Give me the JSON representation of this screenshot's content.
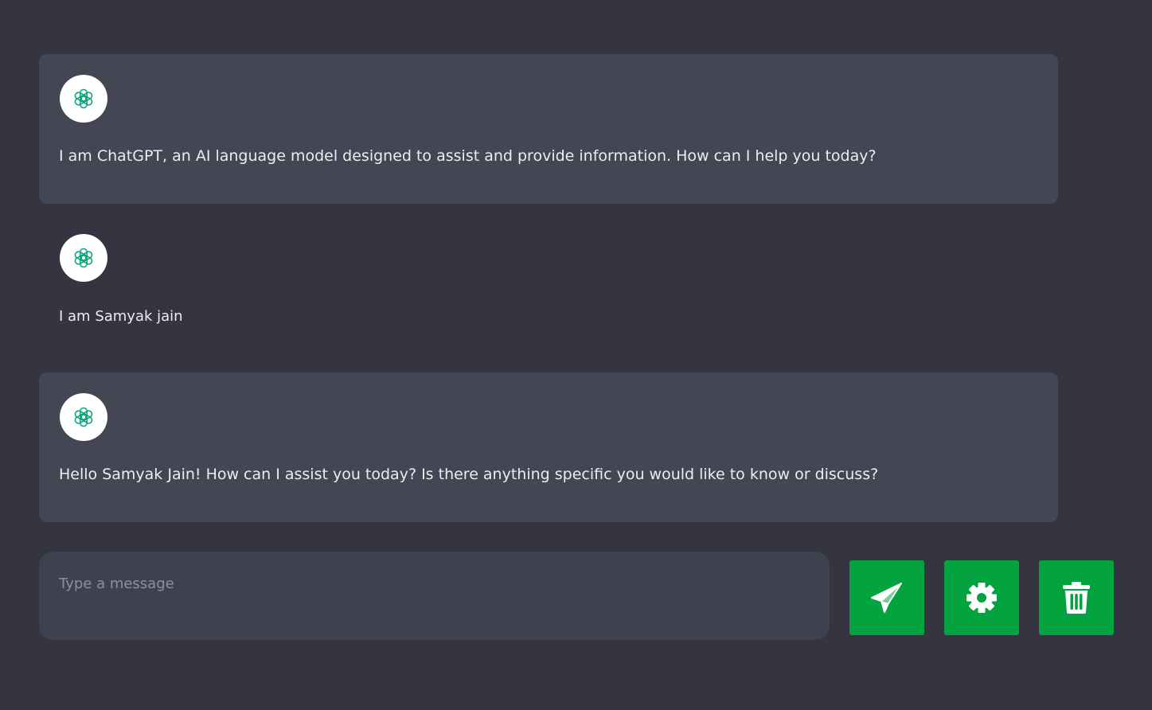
{
  "messages": [
    {
      "role": "assistant",
      "text": "I am ChatGPT, an AI language model designed to assist and provide information. How can I help you today?"
    },
    {
      "role": "user",
      "text": "I am Samyak jain"
    },
    {
      "role": "assistant",
      "text": "Hello Samyak Jain! How can I assist you today? Is there anything specific you would like to know or discuss?"
    }
  ],
  "composer": {
    "placeholder": "Type a message",
    "value": ""
  },
  "actions": {
    "send_icon": "paper-plane-icon",
    "settings_icon": "gear-icon",
    "delete_icon": "trash-icon"
  },
  "theme": {
    "background": "#343541",
    "bot_bubble": "#444654",
    "input_background": "#40414f",
    "accent": "#03a33f",
    "logo_green": "#10a37f"
  }
}
